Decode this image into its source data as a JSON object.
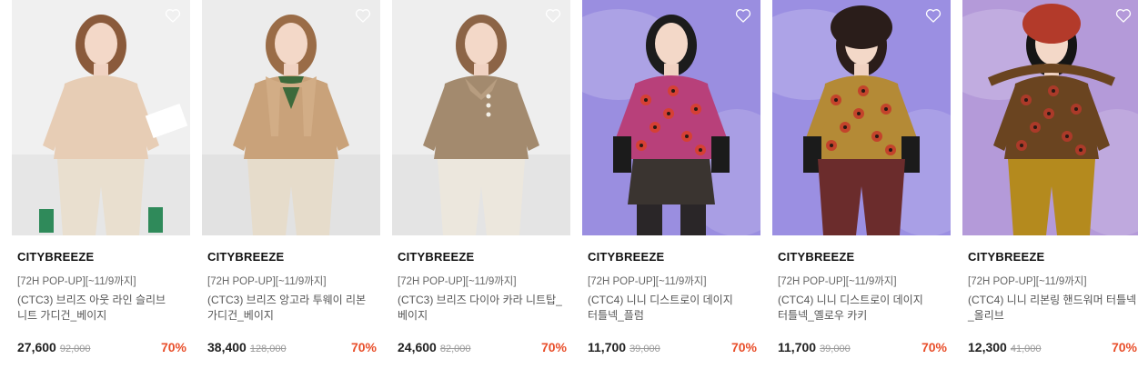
{
  "products": [
    {
      "brand": "CITYBREEZE",
      "promo": "[72H POP-UP][~11/9까지]",
      "title": "(CTC3) 브리즈 아웃 라인 슬리브 니트 가디건_베이지",
      "price": "27,600",
      "original_price": "92,000",
      "discount": "70%",
      "wishlist_icon": "heart-outline-icon",
      "image": {
        "bg": "#f0f0f0",
        "top": "#e7cdb5",
        "pants": "#e9dfcf",
        "hair": "#8a5a3b",
        "accent": "#2f8a5a"
      }
    },
    {
      "brand": "CITYBREEZE",
      "promo": "[72H POP-UP][~11/9까지]",
      "title": "(CTC3) 브리즈 앙고라 투웨이 리본 가디건_베이지",
      "price": "38,400",
      "original_price": "128,000",
      "discount": "70%",
      "wishlist_icon": "heart-outline-icon",
      "image": {
        "bg": "#ececec",
        "top": "#c9a27a",
        "pants": "#e6dccb",
        "hair": "#9a6c47",
        "accent": "#3d6a3b"
      }
    },
    {
      "brand": "CITYBREEZE",
      "promo": "[72H POP-UP][~11/9까지]",
      "title": "(CTC3) 브리즈 다이아 카라 니트탑_베이지",
      "price": "24,600",
      "original_price": "82,000",
      "discount": "70%",
      "wishlist_icon": "heart-outline-icon",
      "image": {
        "bg": "#eeeeee",
        "top": "#a38a6e",
        "pants": "#ece7dd",
        "hair": "#8c6446",
        "accent": "#f3efe6"
      }
    },
    {
      "brand": "CITYBREEZE",
      "promo": "[72H POP-UP][~11/9까지]",
      "title": "(CTC4) 니니 디스트로이 데이지 터틀넥_플럼",
      "price": "11,700",
      "original_price": "39,000",
      "discount": "70%",
      "wishlist_icon": "heart-outline-icon",
      "image": {
        "bg": "#9a8ee0",
        "top": "#b8407a",
        "pants": "#3a3430",
        "hair": "#1c1c1c",
        "accent": "#d8402c"
      }
    },
    {
      "brand": "CITYBREEZE",
      "promo": "[72H POP-UP][~11/9까지]",
      "title": "(CTC4) 니니 디스트로이 데이지 터틀넥_옐로우 카키",
      "price": "11,700",
      "original_price": "39,000",
      "discount": "70%",
      "wishlist_icon": "heart-outline-icon",
      "image": {
        "bg": "#9b8fe2",
        "top": "#b48a36",
        "pants": "#6b2c2c",
        "hair": "#2b1d1a",
        "accent": "#c43b2a"
      }
    },
    {
      "brand": "CITYBREEZE",
      "promo": "[72H POP-UP][~11/9까지]",
      "title": "(CTC4) 니니 리본링 핸드워머 터틀넥_올리브",
      "price": "12,300",
      "original_price": "41,000",
      "discount": "70%",
      "wishlist_icon": "heart-outline-icon",
      "image": {
        "bg": "#b49ad9",
        "top": "#6a4420",
        "pants": "#b48a1e",
        "hair": "#151515",
        "accent": "#b33a2a"
      }
    }
  ]
}
